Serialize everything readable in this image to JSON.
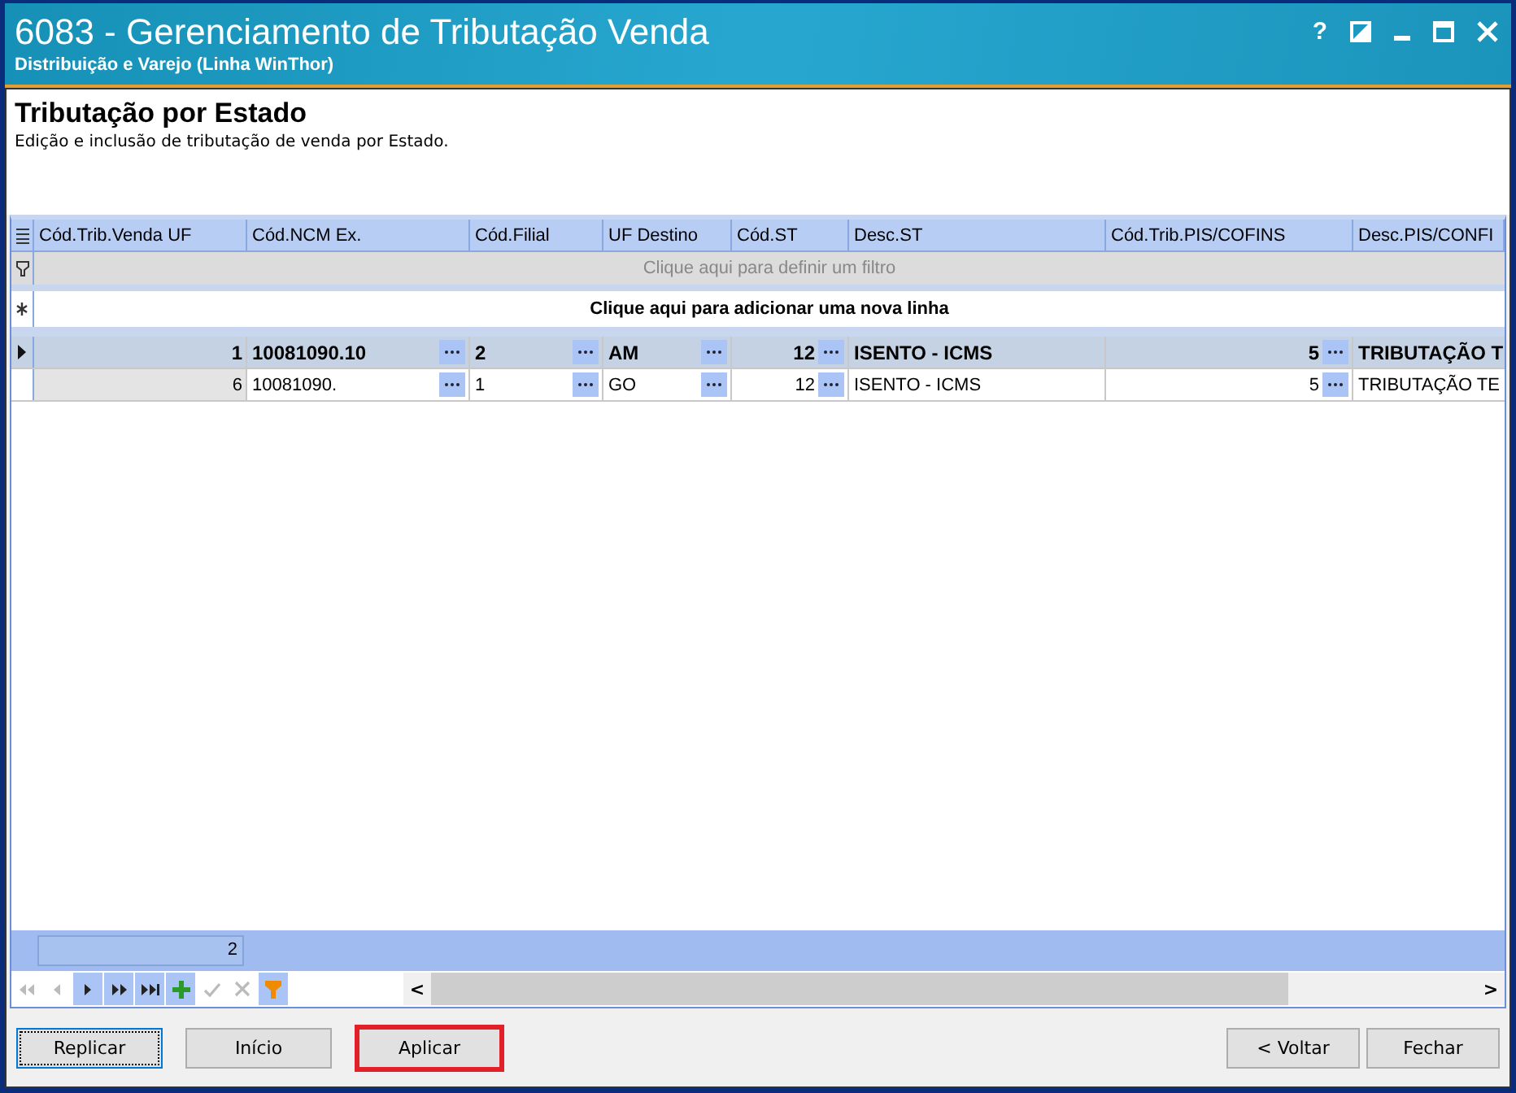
{
  "window": {
    "title": "6083 - Gerenciamento de Tributação Venda",
    "subtitle": "Distribuição e Varejo (Linha WinThor)",
    "controls": [
      {
        "kind": "help",
        "label": "?"
      },
      {
        "kind": "theme"
      },
      {
        "kind": "minimize"
      },
      {
        "kind": "maximize"
      },
      {
        "kind": "close"
      }
    ]
  },
  "page": {
    "heading": "Tributação por Estado",
    "description": "Edição e inclusão de tributação de venda por Estado."
  },
  "grid": {
    "columns": [
      {
        "label": "Cód.Trib.Venda UF",
        "kind": "number",
        "lookup": false
      },
      {
        "label": "Cód.NCM Ex.",
        "kind": "text",
        "lookup": true
      },
      {
        "label": "Cód.Filial",
        "kind": "text",
        "lookup": true
      },
      {
        "label": "UF Destino",
        "kind": "text",
        "lookup": true
      },
      {
        "label": "Cód.ST",
        "kind": "number",
        "lookup": true
      },
      {
        "label": "Desc.ST",
        "kind": "text",
        "lookup": false
      },
      {
        "label": "Cód.Trib.PIS/COFINS",
        "kind": "number",
        "lookup": true
      },
      {
        "label": "Desc.PIS/CONFI",
        "kind": "text",
        "lookup": false
      }
    ],
    "filter_hint": "Clique aqui para definir um filtro",
    "new_row_hint": "Clique aqui para adicionar uma nova linha",
    "rows": [
      {
        "selected": true,
        "cells": [
          "1",
          "10081090.10",
          "2",
          "AM",
          "12",
          "ISENTO - ICMS",
          "5",
          "TRIBUTAÇÃO T"
        ]
      },
      {
        "selected": false,
        "cells": [
          "6",
          "10081090.",
          "1",
          "GO",
          "12",
          "ISENTO - ICMS",
          "5",
          "TRIBUTAÇÃO TE"
        ]
      }
    ],
    "summary": "2",
    "navigator": [
      {
        "kind": "first",
        "disabled": true
      },
      {
        "kind": "prev",
        "disabled": true
      },
      {
        "kind": "next",
        "disabled": false
      },
      {
        "kind": "next-page",
        "disabled": false
      },
      {
        "kind": "last",
        "disabled": false
      },
      {
        "kind": "add",
        "disabled": false
      },
      {
        "kind": "confirm",
        "disabled": true
      },
      {
        "kind": "cancel",
        "disabled": true
      },
      {
        "kind": "filter",
        "disabled": false
      }
    ],
    "scroll_left": "<",
    "scroll_right": ">"
  },
  "buttons_left": [
    {
      "label": "Replicar",
      "focused": true,
      "highlighted": false
    },
    {
      "label": "Início",
      "focused": false,
      "highlighted": false
    },
    {
      "label": "Aplicar",
      "focused": false,
      "highlighted": true
    }
  ],
  "buttons_right": [
    {
      "label": "< Voltar",
      "focused": false,
      "highlighted": false
    },
    {
      "label": "Fechar",
      "focused": false,
      "highlighted": false
    }
  ]
}
